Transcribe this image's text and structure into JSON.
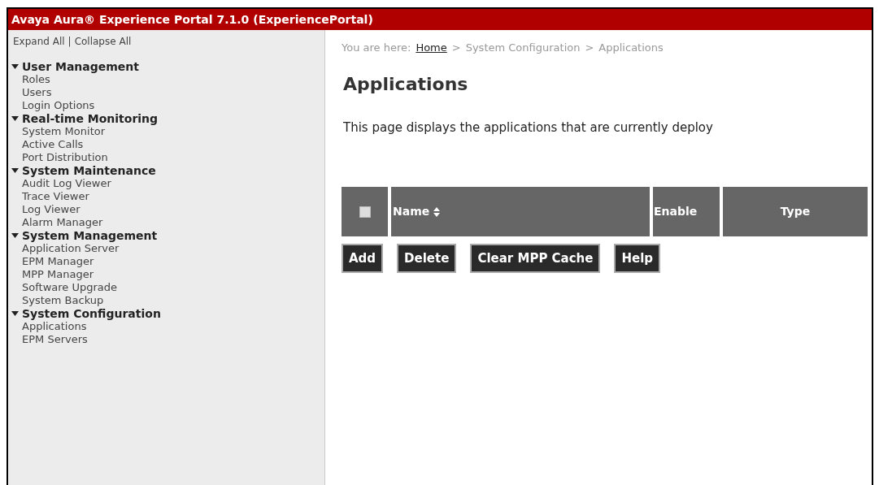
{
  "window": {
    "title": "Avaya Aura® Experience Portal 7.1.0 (ExperiencePortal)"
  },
  "sidebar": {
    "links": [
      "Expand All",
      "Collapse All"
    ],
    "separator": "|",
    "groups": [
      {
        "label": "User Management",
        "expanded": true,
        "children": [
          "Roles",
          "Users",
          "Login Options"
        ]
      },
      {
        "label": "Real-time Monitoring",
        "expanded": true,
        "children": [
          "System Monitor",
          "Active Calls",
          "Port Distribution"
        ]
      },
      {
        "label": "System Maintenance",
        "expanded": true,
        "children": [
          "Audit Log Viewer",
          "Trace Viewer",
          "Log Viewer",
          "Alarm Manager"
        ]
      },
      {
        "label": "System Management",
        "expanded": true,
        "children": [
          "Application Server",
          "EPM Manager",
          "MPP Manager",
          "Software Upgrade",
          "System Backup"
        ]
      },
      {
        "label": "System Configuration",
        "expanded": true,
        "children": [
          "Applications",
          "EPM Servers"
        ]
      }
    ]
  },
  "breadcrumb": {
    "prefix": "You are here:",
    "items": [
      {
        "label": "Home",
        "link": true
      },
      {
        "label": "System Configuration",
        "link": false
      },
      {
        "label": "Applications",
        "link": false
      }
    ],
    "separator": ">"
  },
  "page": {
    "title": "Applications",
    "description": "This page displays the applications that are currently deploy"
  },
  "table": {
    "select_all": {
      "checked": false
    },
    "columns": [
      {
        "label": "Name",
        "sortable": true
      },
      {
        "label": "Enable",
        "sortable": false
      },
      {
        "label": "Type",
        "sortable": false
      }
    ]
  },
  "buttons": [
    "Add",
    "Delete",
    "Clear MPP Cache",
    "Help"
  ]
}
